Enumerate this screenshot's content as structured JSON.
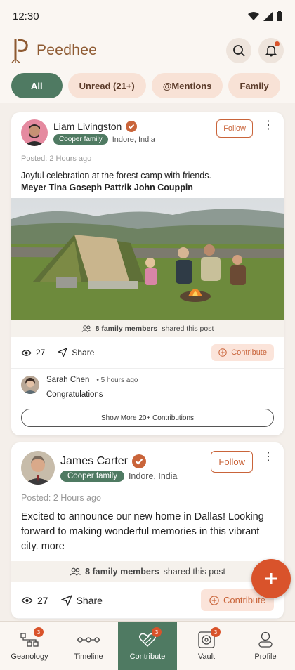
{
  "status_bar": {
    "time": "12:30"
  },
  "app": {
    "name": "Peedhee"
  },
  "filters": [
    {
      "label": "All",
      "active": true
    },
    {
      "label": "Unread (21+)",
      "active": false
    },
    {
      "label": "@Mentions",
      "active": false
    },
    {
      "label": "Family",
      "active": false
    }
  ],
  "posts": [
    {
      "author": "Liam Livingston",
      "family_tag": "Cooper family",
      "location": "Indore, India",
      "follow_label": "Follow",
      "posted": "Posted: 2 Hours ago",
      "text": "Joyful celebration at the forest camp with friends.",
      "mentions": "Meyer Tina Goseph Pattrik John Couppin",
      "shared_count": "8 family members",
      "shared_suffix": "shared this post",
      "views": "27",
      "share_label": "Share",
      "contribute_label": "Contribute",
      "comment": {
        "name": "Sarah Chen",
        "time": "5 hours ago",
        "text": "Congratulations"
      },
      "show_more": "Show More 20+ Contributions"
    },
    {
      "author": "James Carter",
      "family_tag": "Cooper family",
      "location": "Indore, India",
      "follow_label": "Follow",
      "posted": "Posted: 2 Hours ago",
      "text": "Excited to announce our new home in Dallas! Looking forward to making wonderful memories in this vibrant city. more",
      "shared_count": "8 family members",
      "shared_suffix": "shared this post",
      "views": "27",
      "share_label": "Share",
      "contribute_label": "Contribute"
    }
  ],
  "nav": [
    {
      "label": "Geanology",
      "badge": "3",
      "icon": "tree-icon"
    },
    {
      "label": "Timeline",
      "badge": "",
      "icon": "timeline-icon"
    },
    {
      "label": "Contribute",
      "badge": "3",
      "icon": "heart-hands-icon",
      "active": true
    },
    {
      "label": "Vault",
      "badge": "3",
      "icon": "vault-icon"
    },
    {
      "label": "Profile",
      "badge": "",
      "icon": "profile-icon"
    }
  ],
  "colors": {
    "brand": "#8e5a32",
    "accent_green": "#4f7a62",
    "accent_orange": "#d9532b"
  }
}
